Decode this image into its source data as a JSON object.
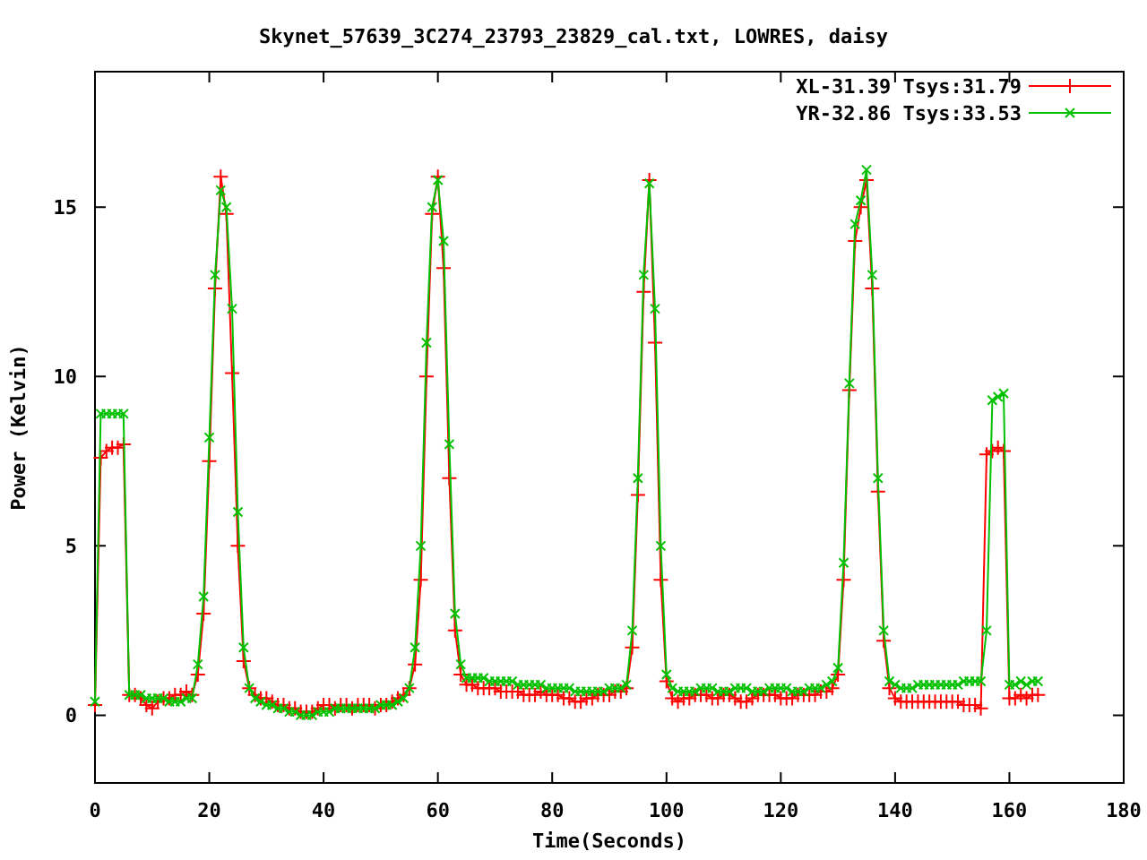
{
  "chart_data": {
    "type": "line",
    "title": "Skynet_57639_3C274_23793_23829_cal.txt, LOWRES, daisy",
    "xlabel": "Time(Seconds)",
    "ylabel": "Power (Kelvin)",
    "xlim": [
      0,
      180
    ],
    "ylim": [
      -2,
      19
    ],
    "xticks": [
      0,
      20,
      40,
      60,
      80,
      100,
      120,
      140,
      160,
      180
    ],
    "yticks": [
      0,
      5,
      10,
      15
    ],
    "legend": "upper right",
    "x": [
      0,
      1,
      2,
      3,
      4,
      5,
      6,
      7,
      8,
      9,
      10,
      11,
      12,
      13,
      14,
      15,
      16,
      17,
      18,
      19,
      20,
      21,
      22,
      23,
      24,
      25,
      26,
      27,
      28,
      29,
      30,
      31,
      32,
      33,
      34,
      35,
      36,
      37,
      38,
      39,
      40,
      41,
      42,
      43,
      44,
      45,
      46,
      47,
      48,
      49,
      50,
      51,
      52,
      53,
      54,
      55,
      56,
      57,
      58,
      59,
      60,
      61,
      62,
      63,
      64,
      65,
      66,
      67,
      68,
      69,
      70,
      71,
      72,
      73,
      74,
      75,
      76,
      77,
      78,
      79,
      80,
      81,
      82,
      83,
      84,
      85,
      86,
      87,
      88,
      89,
      90,
      91,
      92,
      93,
      94,
      95,
      96,
      97,
      98,
      99,
      100,
      101,
      102,
      103,
      104,
      105,
      106,
      107,
      108,
      109,
      110,
      111,
      112,
      113,
      114,
      115,
      116,
      117,
      118,
      119,
      120,
      121,
      122,
      123,
      124,
      125,
      126,
      127,
      128,
      129,
      130,
      131,
      132,
      133,
      134,
      135,
      136,
      137,
      138,
      139,
      140,
      141,
      142,
      143,
      144,
      145,
      146,
      147,
      148,
      149,
      150,
      151,
      152,
      153,
      154,
      155,
      156,
      157,
      158,
      159,
      160,
      161,
      162,
      163,
      164,
      165
    ],
    "series": [
      {
        "name": "XL-31.39 Tsys:31.79",
        "color": "#ff0000",
        "marker": "plus",
        "values": [
          0.3,
          7.6,
          7.8,
          7.9,
          7.9,
          8.0,
          0.6,
          0.6,
          0.5,
          0.3,
          0.2,
          0.4,
          0.5,
          0.5,
          0.6,
          0.6,
          0.7,
          0.6,
          1.2,
          3.0,
          7.5,
          12.6,
          15.9,
          14.8,
          10.1,
          5.0,
          1.6,
          0.8,
          0.6,
          0.5,
          0.5,
          0.4,
          0.3,
          0.3,
          0.2,
          0.2,
          0.1,
          0.1,
          0.1,
          0.2,
          0.3,
          0.3,
          0.2,
          0.3,
          0.3,
          0.2,
          0.3,
          0.3,
          0.3,
          0.2,
          0.3,
          0.3,
          0.4,
          0.5,
          0.6,
          0.8,
          1.5,
          4.0,
          10.0,
          14.8,
          15.9,
          13.2,
          7.0,
          2.5,
          1.2,
          0.9,
          0.9,
          0.8,
          0.8,
          0.8,
          0.8,
          0.7,
          0.7,
          0.7,
          0.7,
          0.6,
          0.6,
          0.6,
          0.7,
          0.6,
          0.6,
          0.6,
          0.5,
          0.5,
          0.4,
          0.4,
          0.5,
          0.5,
          0.6,
          0.6,
          0.6,
          0.7,
          0.7,
          0.8,
          2.0,
          6.5,
          12.5,
          15.8,
          11.0,
          4.0,
          1.0,
          0.5,
          0.4,
          0.5,
          0.5,
          0.6,
          0.6,
          0.6,
          0.5,
          0.5,
          0.6,
          0.6,
          0.5,
          0.4,
          0.4,
          0.5,
          0.6,
          0.6,
          0.6,
          0.6,
          0.5,
          0.5,
          0.5,
          0.6,
          0.6,
          0.6,
          0.6,
          0.7,
          0.7,
          0.8,
          1.2,
          4.0,
          9.6,
          14.0,
          15.0,
          15.8,
          12.6,
          6.6,
          2.2,
          0.8,
          0.5,
          0.4,
          0.4,
          0.4,
          0.4,
          0.4,
          0.4,
          0.4,
          0.4,
          0.4,
          0.4,
          0.4,
          0.3,
          0.3,
          0.3,
          0.2,
          7.7,
          7.8,
          7.9,
          7.8,
          0.5,
          0.5,
          0.6,
          0.5,
          0.6,
          0.6
        ]
      },
      {
        "name": "YR-32.86 Tsys:33.53",
        "color": "#00c000",
        "marker": "cross",
        "values": [
          0.4,
          8.9,
          8.9,
          8.9,
          8.9,
          8.9,
          0.6,
          0.6,
          0.6,
          0.5,
          0.5,
          0.5,
          0.5,
          0.4,
          0.4,
          0.4,
          0.5,
          0.5,
          1.5,
          3.5,
          8.2,
          13.0,
          15.5,
          15.0,
          12.0,
          6.0,
          2.0,
          0.8,
          0.5,
          0.4,
          0.3,
          0.3,
          0.2,
          0.2,
          0.1,
          0.1,
          0.0,
          0.0,
          0.0,
          0.1,
          0.1,
          0.1,
          0.2,
          0.2,
          0.2,
          0.2,
          0.2,
          0.2,
          0.2,
          0.2,
          0.3,
          0.3,
          0.3,
          0.4,
          0.5,
          0.8,
          2.0,
          5.0,
          11.0,
          15.0,
          15.8,
          14.0,
          8.0,
          3.0,
          1.5,
          1.1,
          1.1,
          1.1,
          1.1,
          1.0,
          1.0,
          1.0,
          1.0,
          1.0,
          0.9,
          0.9,
          0.9,
          0.9,
          0.9,
          0.8,
          0.8,
          0.8,
          0.8,
          0.8,
          0.7,
          0.7,
          0.7,
          0.7,
          0.7,
          0.7,
          0.8,
          0.8,
          0.8,
          0.9,
          2.5,
          7.0,
          13.0,
          15.7,
          12.0,
          5.0,
          1.2,
          0.8,
          0.7,
          0.7,
          0.7,
          0.7,
          0.8,
          0.8,
          0.8,
          0.7,
          0.7,
          0.7,
          0.8,
          0.8,
          0.8,
          0.7,
          0.7,
          0.7,
          0.8,
          0.8,
          0.8,
          0.8,
          0.7,
          0.7,
          0.7,
          0.8,
          0.8,
          0.8,
          0.9,
          1.0,
          1.4,
          4.5,
          9.8,
          14.5,
          15.2,
          16.1,
          13.0,
          7.0,
          2.5,
          1.0,
          0.9,
          0.8,
          0.8,
          0.8,
          0.9,
          0.9,
          0.9,
          0.9,
          0.9,
          0.9,
          0.9,
          0.9,
          1.0,
          1.0,
          1.0,
          1.0,
          2.5,
          9.3,
          9.4,
          9.5,
          0.9,
          0.9,
          1.0,
          0.9,
          1.0,
          1.0
        ]
      }
    ]
  }
}
